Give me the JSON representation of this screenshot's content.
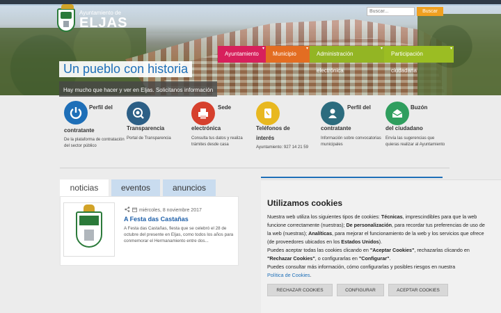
{
  "header": {
    "logo_small": "Ayuntamiento de",
    "logo_big": "ELJAS",
    "search_placeholder": "Buscar...",
    "search_button": "Buscar"
  },
  "nav": {
    "items": [
      {
        "label": "Ayuntamiento"
      },
      {
        "label": "Municipio"
      },
      {
        "label": "Administración electrónica"
      },
      {
        "label": "Participación ciudadana"
      }
    ]
  },
  "hero": {
    "slogan": "Un pueblo con historia",
    "subslogan": "Hay mucho que hacer y ver en Eljas. Solicitanos información"
  },
  "services": [
    {
      "title_top": "Perfil del",
      "title_bottom": "contratante",
      "desc": "De la plataforma de contratación del sector público",
      "icon": "power-icon",
      "color": "#1e6fb8"
    },
    {
      "title_top": "",
      "title_bottom": "Transparencia",
      "desc": "Portal de Transparencia",
      "icon": "eye-icon",
      "color": "#2c5f86"
    },
    {
      "title_top": "Sede",
      "title_bottom": "electrónica",
      "desc": "Consulta tus datos y realiza trámites desde casa",
      "icon": "printer-icon",
      "color": "#d6402d"
    },
    {
      "title_top": "Teléfonos de",
      "title_bottom": "interés",
      "desc": "Ayuntamiento: 927 14 21 59",
      "icon": "phone-icon",
      "color": "#e8b820"
    },
    {
      "title_top": "Perfil del",
      "title_bottom": "contratante",
      "desc": "Información sobre convocatorias municipales",
      "icon": "user-icon",
      "color": "#2c6c7e"
    },
    {
      "title_top": "Buzón",
      "title_bottom": "del ciudadano",
      "desc": "Envía las sugerencias que quieras realizar al Ayuntamiento",
      "icon": "mail-icon",
      "color": "#2f9e5e"
    }
  ],
  "tabs": [
    {
      "label": "noticias"
    },
    {
      "label": "eventos"
    },
    {
      "label": "anuncios"
    }
  ],
  "news": {
    "date": "miércoles, 8 noviembre 2017",
    "title": "A Festa das Castañas",
    "excerpt": "A Festa das Castañas, fiesta que se celebró el 28 de octubre del presente en Eljas, como todos los años para conmemorar el Hermanamiento entre dos..."
  },
  "cookie": {
    "title": "Utilizamos cookies",
    "p1_a": "Nuestra web utiliza los siguientes tipos de cookies: ",
    "p1_b": "Técnicas",
    "p1_c": ", imprescindibles para que la web funcione correctamente (nuestras); ",
    "p1_d": "De personalización",
    "p1_e": ", para recordar tus preferencias de uso de la web (nuestras); ",
    "p1_f": "Analíticas",
    "p1_g": ", para mejorar el funcionamiento de la web y los servicios que ofrece (de proveedores ubicados en los ",
    "p1_h": "Estados Unidos",
    "p1_i": ").",
    "p2_a": "Puedes aceptar todas las cookies clicando en ",
    "p2_b": "\"Aceptar Cookies\"",
    "p2_c": ", rechazarlas clicando en ",
    "p2_d": "\"Rechazar Cookies\"",
    "p2_e": ", o configurarlas en ",
    "p2_f": "\"Configurar\"",
    "p2_g": ".",
    "p3": "Puedes consultar más información, cómo configurarlas y posibles riesgos en nuestra",
    "policy_link": "Política de Cookies",
    "policy_end": ".",
    "btn_reject": "RECHAZAR COOKIES",
    "btn_config": "CONFIGURAR",
    "btn_accept": "ACEPTAR COOKIES"
  }
}
